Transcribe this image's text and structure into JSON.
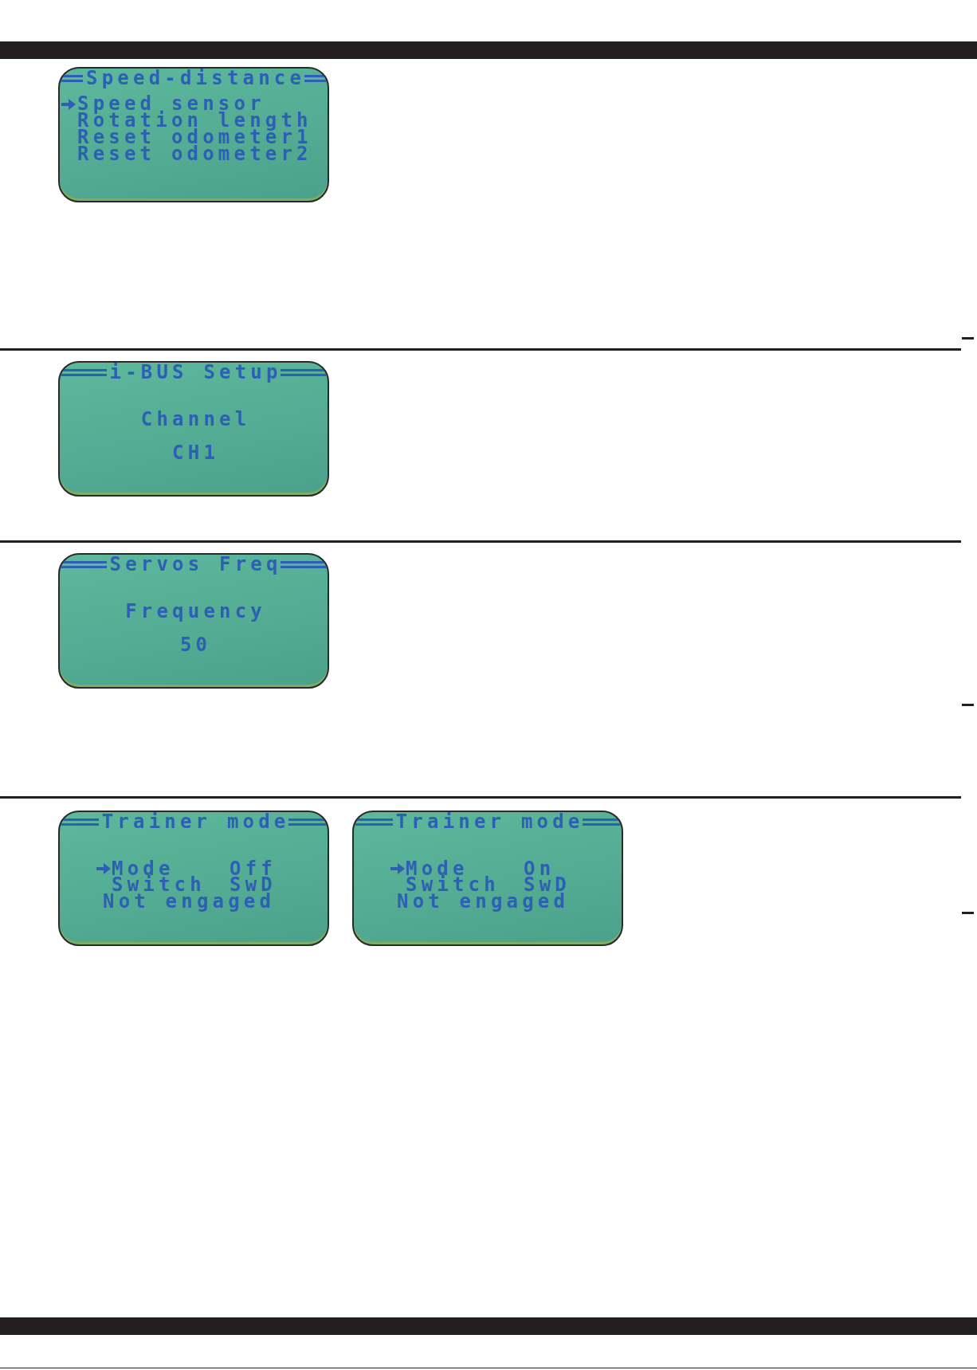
{
  "sections": [
    {
      "screens": [
        {
          "kind": "menu",
          "title": "Speed-distance",
          "items": [
            {
              "label": "Speed sensor",
              "selected": true
            },
            {
              "label": "Rotation length",
              "selected": false
            },
            {
              "label": "Reset odometer1",
              "selected": false
            },
            {
              "label": "Reset odometer2",
              "selected": false
            }
          ]
        }
      ]
    },
    {
      "screens": [
        {
          "kind": "value",
          "title": "i-BUS Setup",
          "label": "Channel",
          "value": "CH1"
        }
      ]
    },
    {
      "screens": [
        {
          "kind": "value",
          "title": "Servos Freq",
          "label": "Frequency",
          "value": "50"
        }
      ]
    },
    {
      "screens": [
        {
          "kind": "settings",
          "title": "Trainer mode",
          "settings": [
            {
              "label": "Mode",
              "value": "Off",
              "selected": true
            },
            {
              "label": "Switch",
              "value": "SwD",
              "selected": false
            }
          ],
          "status": "Not engaged"
        },
        {
          "kind": "settings",
          "title": "Trainer mode",
          "settings": [
            {
              "label": "Mode",
              "value": "On",
              "selected": true
            },
            {
              "label": "Switch",
              "value": "SwD",
              "selected": false
            }
          ],
          "status": "Not engaged"
        }
      ]
    }
  ]
}
